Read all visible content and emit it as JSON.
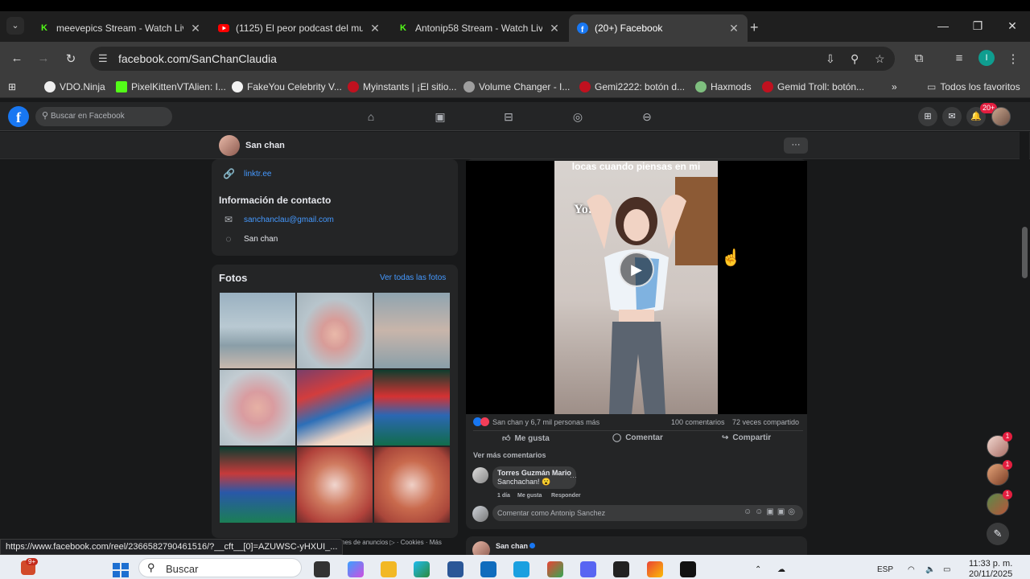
{
  "browser": {
    "tabs": [
      {
        "title": "meevepics Stream - Watch Live",
        "icon": "kick-icon",
        "color": "#53fc18"
      },
      {
        "title": "(1125) El peor podcast del mun",
        "icon": "youtube-icon",
        "color": "#ff0000"
      },
      {
        "title": "Antonip58 Stream - Watch Live",
        "icon": "kick-icon",
        "color": "#53fc18"
      },
      {
        "title": "(20+) Facebook",
        "icon": "facebook-icon",
        "color": "#1877f2"
      }
    ],
    "url": "facebook.com/SanChanClaudia",
    "bookmarks": [
      {
        "label": "VDO.Ninja",
        "color": "#eeeeee"
      },
      {
        "label": "PixelKittenVTAlien: I...",
        "color": "#53fc18"
      },
      {
        "label": "FakeYou Celebrity V...",
        "color": "#f2f2f2"
      },
      {
        "label": "Myinstants | ¡El sitio...",
        "color": "#c0111f"
      },
      {
        "label": "Volume Changer - I...",
        "color": "#9e9e9e"
      },
      {
        "label": "Gemi2222: botón d...",
        "color": "#c0111f"
      },
      {
        "label": "Haxmods",
        "color": "#7fbf7f"
      },
      {
        "label": "Gemid Troll: botón...",
        "color": "#c0111f"
      }
    ],
    "bookmarks_more": "»",
    "all_bookmarks": "Todos los favoritos",
    "status_url": "https://www.facebook.com/reel/236658279046151​6/?__cft__[0]=AZUWSC-yHXUI_..."
  },
  "facebook": {
    "search_placeholder": "Buscar en Facebook",
    "notif_badge": "20+",
    "profile_name": "San chan",
    "more_button": "···",
    "intro": {
      "link": "linktr.ee",
      "contact_title": "Información de contacto",
      "email": "sanchanclau@gmail.com",
      "messenger": "San chan"
    },
    "photos": {
      "title": "Fotos",
      "see_all": "Ver todas las fotos"
    },
    "post": {
      "video_caption": "locas cuando piensas en mi",
      "video_overlay": "Yo:",
      "reactions": "San chan y 6,7 mil personas más",
      "comments_count": "100 comentarios",
      "shares_count": "72 veces compartido",
      "like": "Me gusta",
      "comment": "Comentar",
      "share": "Compartir",
      "more_comments": "Ver más comentarios",
      "top_comment": {
        "author": "Torres Guzmán Mario",
        "text": "Sanchachan! 😮",
        "time": "1 día",
        "like": "Me gusta",
        "reply": "Responder",
        "more": "···"
      },
      "comment_placeholder": "Comentar como Antonip Sanchez"
    },
    "next_post_author": "San chan",
    "footer": "nes de anuncios ▷ · Cookies · Más",
    "chat_badges": [
      "1",
      "1",
      "1"
    ]
  },
  "taskbar": {
    "search_label": "Buscar",
    "notif": "9+",
    "lang": "ESP",
    "time": "11:33 p. m.",
    "date": "20/11/2025"
  }
}
